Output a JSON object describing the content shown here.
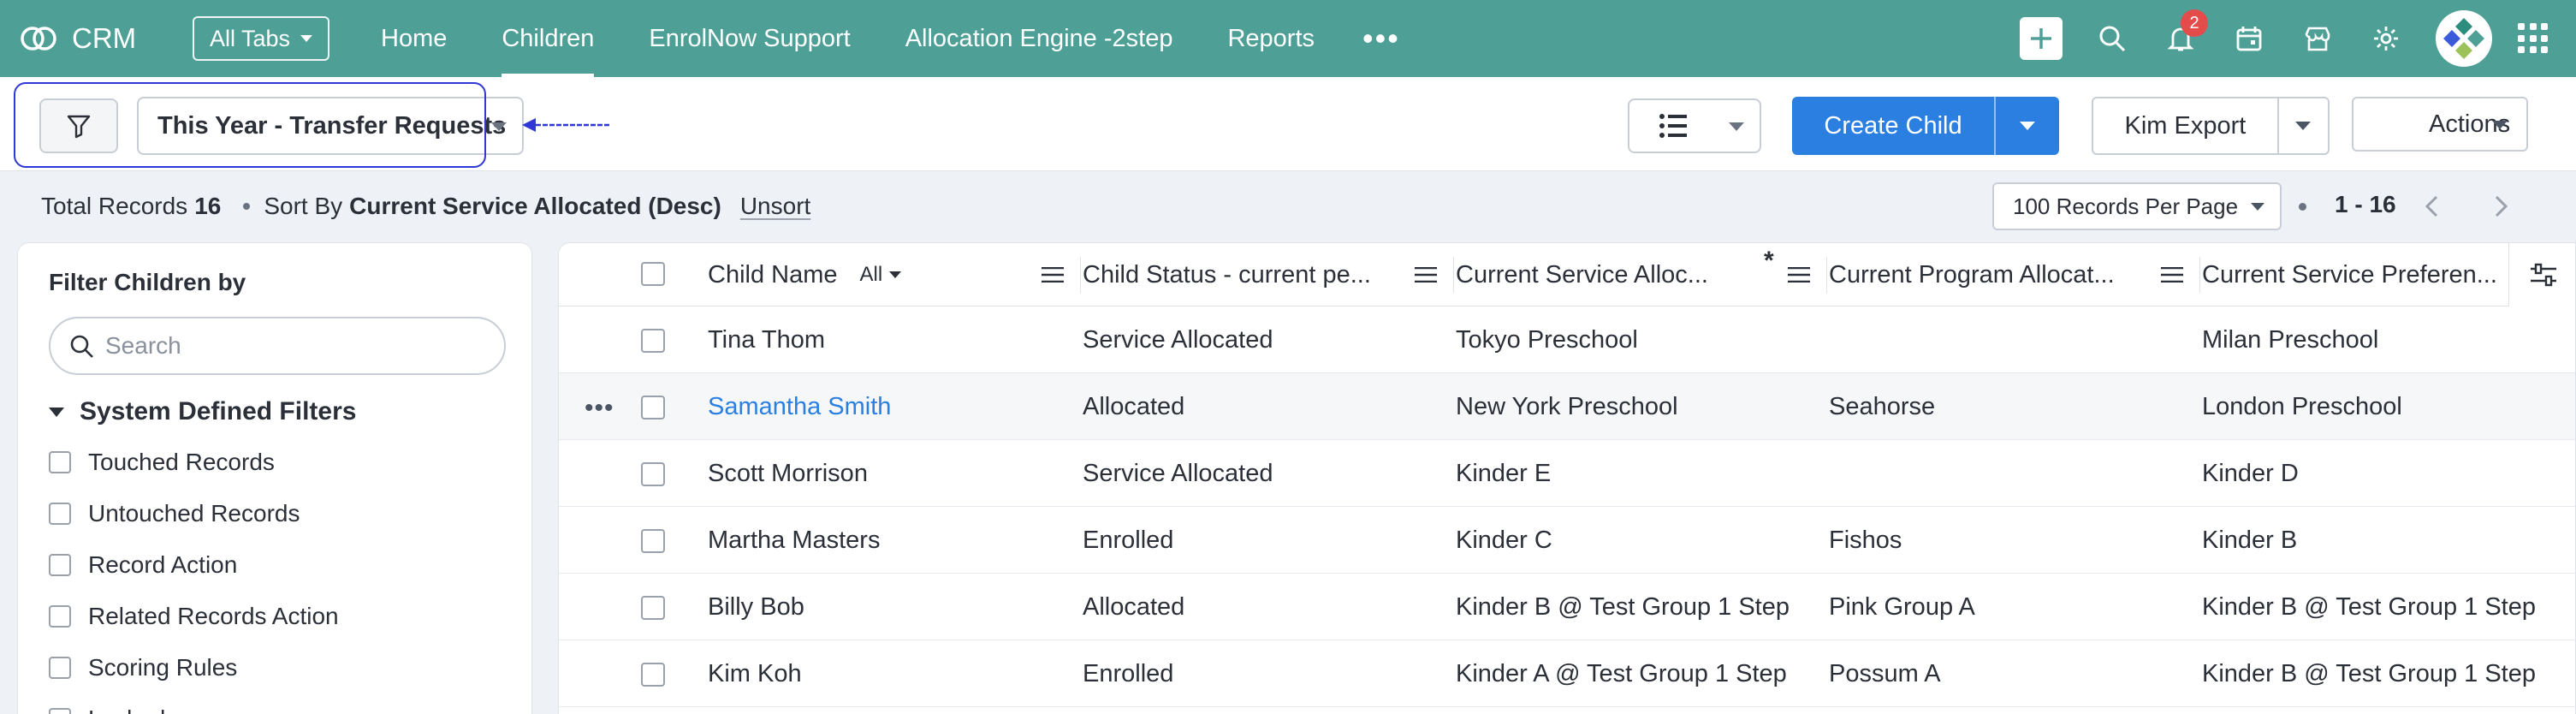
{
  "app": {
    "name": "CRM"
  },
  "nav": {
    "all_tabs": "All Tabs",
    "tabs": [
      "Home",
      "Children",
      "EnrolNow Support",
      "Allocation Engine -2step",
      "Reports"
    ],
    "active_tab": "Children",
    "notification_count": "2"
  },
  "toolbar": {
    "view_name": "This Year - Transfer Requests",
    "create_button": "Create Child",
    "export_button": "Kim Export",
    "actions_button": "Actions"
  },
  "summary": {
    "total_label": "Total Records",
    "total_count": "16",
    "sort_label": "Sort By",
    "sort_value": "Current Service Allocated (Desc)",
    "unsort": "Unsort",
    "per_page": "100 Records Per Page",
    "range": "1 - 16"
  },
  "filter_panel": {
    "title": "Filter Children by",
    "search_placeholder": "Search",
    "section_title": "System Defined Filters",
    "items": [
      "Touched Records",
      "Untouched Records",
      "Record Action",
      "Related Records Action",
      "Scoring Rules",
      "Locked"
    ]
  },
  "table": {
    "columns": [
      "Child Name",
      "Child Status - current pe...",
      "Current Service Alloc...",
      "Current Program Allocat...",
      "Current Service Preferen..."
    ],
    "name_filter": "All",
    "rows": [
      [
        "Tina Thom",
        "Service Allocated",
        "Tokyo Preschool",
        "",
        "Milan Preschool"
      ],
      [
        "Samantha Smith",
        "Allocated",
        "New York Preschool",
        "Seahorse",
        "London Preschool"
      ],
      [
        "Scott Morrison",
        "Service Allocated",
        "Kinder E",
        "",
        "Kinder D"
      ],
      [
        "Martha Masters",
        "Enrolled",
        "Kinder C",
        "Fishos",
        "Kinder B"
      ],
      [
        "Billy Bob",
        "Allocated",
        "Kinder B @ Test Group 1 Step",
        "Pink Group A",
        "Kinder B @ Test Group 1 Step"
      ],
      [
        "Kim Koh",
        "Enrolled",
        "Kinder A @ Test Group 1 Step",
        "Possum A",
        "Kinder B @ Test Group 1 Step"
      ]
    ]
  },
  "colors": {
    "nav_bg": "#4ea097",
    "primary": "#2a7fe0",
    "annotation": "#2f37d6",
    "badge": "#e44b4b"
  }
}
